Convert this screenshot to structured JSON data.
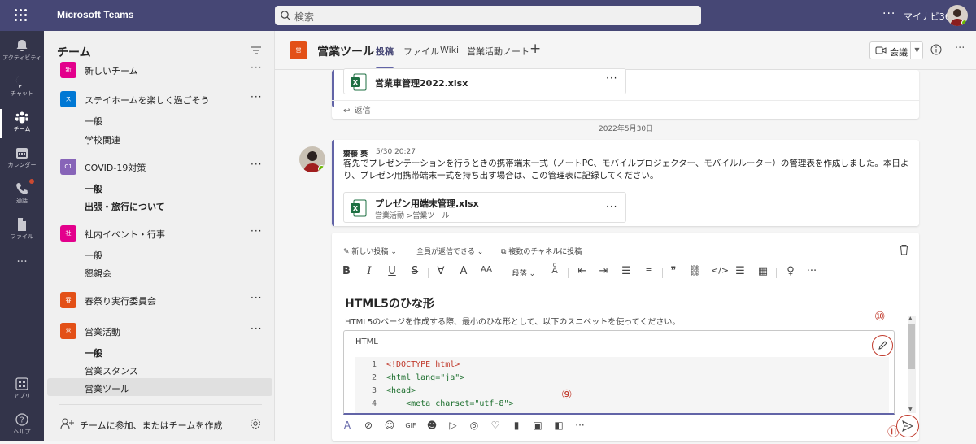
{
  "app": {
    "title": "Microsoft Teams",
    "tenant": "マイナビ365",
    "more": "···"
  },
  "search": {
    "placeholder": "検索"
  },
  "rail": {
    "items": [
      {
        "label": "アクティビティ"
      },
      {
        "label": "チャット"
      },
      {
        "label": "チーム"
      },
      {
        "label": "カレンダー"
      },
      {
        "label": "通話"
      },
      {
        "label": "ファイル"
      },
      {
        "label": "···"
      },
      {
        "label": "アプリ"
      },
      {
        "label": "ヘルプ"
      }
    ],
    "active": "チーム"
  },
  "teams_panel": {
    "title": "チーム",
    "teams": [
      {
        "name": "新しいチーム",
        "tile": "新",
        "tile_color": "#e3008c",
        "more": "···",
        "channels": []
      },
      {
        "name": "ステイホームを楽しく過ごそう",
        "tile": "ス",
        "tile_color": "#0078d4",
        "more": "···",
        "channels": [
          "一般",
          "学校関連"
        ]
      },
      {
        "name": "COVID-19対策",
        "tile": "C1",
        "tile_color": "#8764b8",
        "more": "···",
        "channels": [
          "一般",
          "出張・旅行について"
        ]
      },
      {
        "name": "社内イベント・行事",
        "tile": "社",
        "tile_color": "#e3008c",
        "more": "···",
        "channels": [
          "一般",
          "懇親会"
        ]
      },
      {
        "name": "春祭り実行委員会",
        "tile": "春",
        "tile_color": "#e35017",
        "more": "···",
        "channels": []
      },
      {
        "name": "営業活動",
        "tile": "営",
        "tile_color": "#e35017",
        "more": "···",
        "channels": [
          "一般",
          "営業スタンス",
          "営業ツール"
        ]
      }
    ],
    "join_label": "チームに参加、またはチームを作成"
  },
  "channel": {
    "tile": "営",
    "name": "営業ツール",
    "tabs": [
      "投稿",
      "ファイル",
      "Wiki",
      "営業活動ノート"
    ],
    "active_tab": "投稿",
    "add_tab": "+",
    "meet_label": "会議",
    "more": "···"
  },
  "feed": {
    "prev_file": {
      "name": "営業車管理2022.xlsx",
      "more": "···"
    },
    "reply_label": "返信",
    "date_separator": "2022年5月30日",
    "message": {
      "author": "齋藤 葵",
      "time": "5/30 20:27",
      "body": "客先でプレゼンテーションを行うときの携帯端末一式（ノートPC、モバイルプロジェクター、モバイルルーター）の管理表を作成しました。本日より、プレゼン用携帯端末一式を持ち出す場合は、この管理表に記録してください。",
      "file": {
        "name": "プレゼン用端末管理.xlsx",
        "path": "営業活動 >営業ツール",
        "more": "···"
      }
    }
  },
  "compose": {
    "toolbar": {
      "new_post": "新しい投稿",
      "reply_setting": "全員が返信できる",
      "multi_channel": "複数のチャネルに投稿"
    },
    "format": {
      "bold": "B",
      "italic": "I",
      "underline": "U",
      "strike": "S",
      "fontsize": "AA",
      "paragraph": "段落",
      "more": "···"
    },
    "subject": "HTML5のひな形",
    "description": "HTML5のページを作成する際、最小のひな形として、以下のスニペットを使ってください。",
    "code": {
      "language": "HTML",
      "lines": [
        {
          "n": "1",
          "text": "<!DOCTYPE html>"
        },
        {
          "n": "2",
          "text": "<html lang=\"ja\">"
        },
        {
          "n": "3",
          "text": "<head>"
        },
        {
          "n": "4",
          "text": "    <meta charset=\"utf-8\">"
        }
      ]
    },
    "annotations": {
      "nine": "⑨",
      "ten": "⑩",
      "eleven": "⑪"
    },
    "bottom_more": "···"
  },
  "colors": {
    "topbar": "#464775",
    "rail": "#33344a",
    "accent": "#6264a7",
    "annotation": "#c0392b",
    "excel": "#1d6f42"
  }
}
